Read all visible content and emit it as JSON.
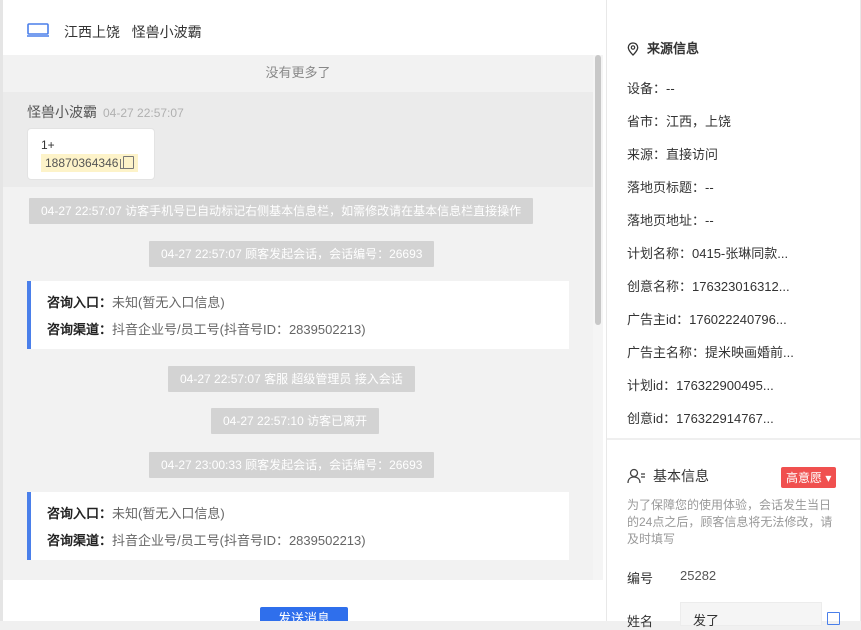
{
  "header": {
    "location": "江西上饶",
    "visitor": "怪兽小波霸",
    "icon": "laptop-icon"
  },
  "chat": {
    "no_more": "没有更多了",
    "message": {
      "sender": "怪兽小波霸",
      "time": "04-27 22:57:07",
      "line1": "1+",
      "phone": "18870364346"
    },
    "system_1": "04-27 22:57:07 访客手机号已自动标记右侧基本信息栏，如需修改请在基本信息栏直接操作",
    "system_2": "04-27 22:57:07 顾客发起会话，会话编号：26693",
    "card_1": {
      "entry_label": "咨询入口：",
      "entry_value": "未知(暂无入口信息)",
      "channel_label": "咨询渠道：",
      "channel_value": "抖音企业号/员工号(抖音号ID：2839502213)"
    },
    "system_3": "04-27 22:57:07 客服 超级管理员 接入会话",
    "system_4": "04-27 22:57:10 访客已离开",
    "system_5": "04-27 23:00:33 顾客发起会话，会话编号：26693",
    "card_2": {
      "entry_label": "咨询入口：",
      "entry_value": "未知(暂无入口信息)",
      "channel_label": "咨询渠道：",
      "channel_value": "抖音企业号/员工号(抖音号ID：2839502213)"
    },
    "send_label": "发送消息"
  },
  "source": {
    "title": "来源信息",
    "rows": [
      "设备：--",
      "省市：江西，上饶",
      "来源：直接访问",
      "落地页标题：--",
      "落地页地址：--",
      "计划名称：0415-张琳同款...",
      "创意名称：176323016312...",
      "广告主id：176022240796...",
      "广告主名称：提米映画婚前...",
      "计划id：176322900495...",
      "创意id：176322914767..."
    ]
  },
  "basic": {
    "title": "基本信息",
    "badge": "高意愿",
    "note": "为了保障您的使用体验，会话发生当日的24点之后，顾客信息将无法修改，请及时填写",
    "number_label": "编号",
    "number_value": "25282",
    "name_label": "姓名",
    "name_value": "发了"
  },
  "colors": {
    "accent": "#2f6fec",
    "card_border": "#4a7fea",
    "badge": "#f0504f",
    "phone_highlight": "#fdf3c9"
  }
}
